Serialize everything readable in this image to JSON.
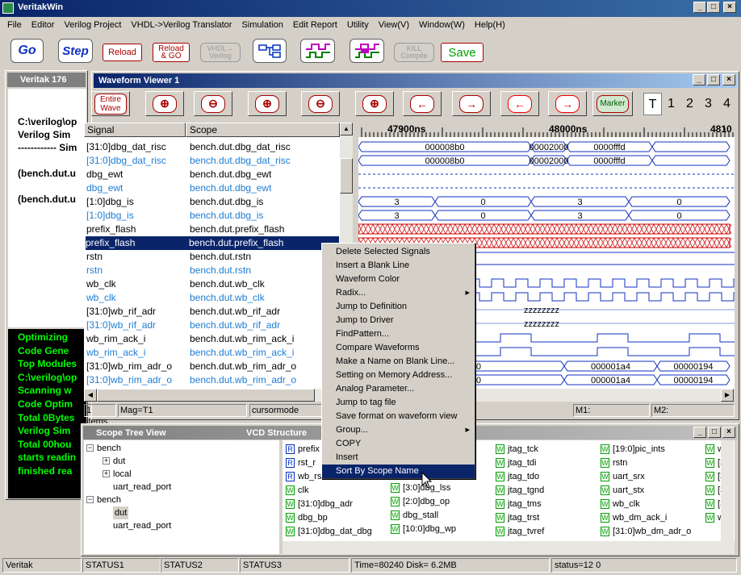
{
  "app": {
    "title": "VeritakWin"
  },
  "menu": [
    "File",
    "Editor",
    "Verilog Project",
    "VHDL->Verilog Translator",
    "Simulation",
    "Edit Report",
    "Utility",
    "View(V)",
    "Window(W)",
    "Help(H)"
  ],
  "toolbar": {
    "go": "Go",
    "step": "Step",
    "reload": "Reload",
    "reload_go_1": "Reload",
    "reload_go_2": "& GO",
    "vhdl_1": "VHDL→",
    "vhdl_2": "Verilog",
    "kill_1": "KILL",
    "kill_2": "Compile",
    "save": "Save"
  },
  "console": {
    "title": "Veritak 176",
    "lines": [
      "C:\\verilog\\op",
      "Verilog Sim",
      "------------ Sim",
      "(bench.dut.u",
      "(bench.dut.u"
    ]
  },
  "green_console": {
    "lines": [
      "Optimizing",
      "Code Gene",
      "Top Modules",
      "C:\\verilog\\op",
      "Scanning w",
      "Code Optim",
      "Total 0Bytes",
      "Verilog Sim",
      "Total 00hou",
      "starts readin",
      "finished rea"
    ]
  },
  "waveform": {
    "title": "Waveform Viewer 1",
    "entire_wave_1": "Entire",
    "entire_wave_2": "Wave",
    "marker": "Marker",
    "tabs": [
      "T",
      "1",
      "2",
      "3",
      "4"
    ],
    "col_signal": "Signal",
    "col_scope": "Scope",
    "signals": [
      {
        "name": "[31:0]dbg_dat_risc",
        "scope": "bench.dut.dbg_dat_risc",
        "blue": false
      },
      {
        "name": "[31:0]dbg_dat_risc",
        "scope": "bench.dut.dbg_dat_risc",
        "blue": true
      },
      {
        "name": "dbg_ewt",
        "scope": "bench.dut.dbg_ewt",
        "blue": false
      },
      {
        "name": "dbg_ewt",
        "scope": "bench.dut.dbg_ewt",
        "blue": true
      },
      {
        "name": "[1:0]dbg_is",
        "scope": "bench.dut.dbg_is",
        "blue": false
      },
      {
        "name": "[1:0]dbg_is",
        "scope": "bench.dut.dbg_is",
        "blue": true
      },
      {
        "name": "prefix_flash",
        "scope": "bench.dut.prefix_flash",
        "blue": false
      },
      {
        "name": "prefix_flash",
        "scope": "bench.dut.prefix_flash",
        "blue": false,
        "selected": true
      },
      {
        "name": "rstn",
        "scope": "bench.dut.rstn",
        "blue": false
      },
      {
        "name": "rstn",
        "scope": "bench.dut.rstn",
        "blue": true
      },
      {
        "name": "wb_clk",
        "scope": "bench.dut.wb_clk",
        "blue": false
      },
      {
        "name": "wb_clk",
        "scope": "bench.dut.wb_clk",
        "blue": true
      },
      {
        "name": "[31:0]wb_rif_adr",
        "scope": "bench.dut.wb_rif_adr",
        "blue": false
      },
      {
        "name": "[31:0]wb_rif_adr",
        "scope": "bench.dut.wb_rif_adr",
        "blue": true
      },
      {
        "name": "wb_rim_ack_i",
        "scope": "bench.dut.wb_rim_ack_i",
        "blue": false
      },
      {
        "name": "wb_rim_ack_i",
        "scope": "bench.dut.wb_rim_ack_i",
        "blue": true
      },
      {
        "name": "[31:0]wb_rim_adr_o",
        "scope": "bench.dut.wb_rim_adr_o",
        "blue": false
      },
      {
        "name": "[31:0]wb_rim_adr_o",
        "scope": "bench.dut.wb_rim_adr_o",
        "blue": true
      }
    ],
    "time_labels": [
      "47900ns",
      "48000ns",
      "4810"
    ],
    "bus_vals_1": [
      "000008b0",
      "00002000",
      "0000fffd"
    ],
    "bus_vals_2": [
      "000008b0",
      "00002000",
      "0000fffd"
    ],
    "is_vals": [
      "3",
      "0",
      "3",
      "0"
    ],
    "zz": "zzzzzzzz",
    "adr_vals": [
      "000001a0",
      "000001a4",
      "00000194"
    ],
    "status": {
      "items": "1 items.",
      "mag": "Mag=T1",
      "mode": "cursormode",
      "m1": "M1:",
      "m2": "M2:"
    }
  },
  "context_menu": {
    "items": [
      "Delete Selected Signals",
      "Insert a Blank Line",
      "Waveform Color",
      "Radix...",
      "Jump to Definition",
      "Jump to Driver",
      "FindPattern...",
      "Compare Waveforms",
      "Make a Name on Blank Line...",
      "Setting on Memory Address...",
      "Analog Parameter...",
      "Jump to tag file",
      "Save format on waveform view",
      "Group...",
      "COPY",
      "Insert",
      "Sort By Scope Name"
    ]
  },
  "scope_tree": {
    "title": "Scope Tree View",
    "vcd_title": "VCD Structure",
    "nodes": [
      "bench",
      "dut",
      "local",
      "uart_read_port",
      "bench",
      "dut",
      "uart_read_port"
    ]
  },
  "vcd": {
    "col1": [
      [
        "R",
        "prefix"
      ],
      [
        "R",
        "rst_r"
      ],
      [
        "R",
        "wb_rs"
      ],
      [
        "W",
        "clk"
      ],
      [
        "W",
        "[31:0]dbg_adr"
      ],
      [
        "W",
        "dbg_bp"
      ],
      [
        "W",
        "[31:0]dbg_dat_dbg"
      ]
    ],
    "col2": [
      [
        "W",
        "[3:0]dbg_lss"
      ],
      [
        "W",
        "[2:0]dbg_op"
      ],
      [
        "W",
        "dbg_stall"
      ],
      [
        "W",
        "[10:0]dbg_wp"
      ]
    ],
    "col3": [
      [
        "W",
        "jtag_tck"
      ],
      [
        "W",
        "jtag_tdi"
      ],
      [
        "W",
        "jtag_tdo"
      ],
      [
        "W",
        "jtag_tgnd"
      ],
      [
        "W",
        "jtag_tms"
      ],
      [
        "W",
        "jtag_trst"
      ],
      [
        "W",
        "jtag_tvref"
      ]
    ],
    "col4": [
      [
        "W",
        "[19:0]pic_ints"
      ],
      [
        "W",
        "rstn"
      ],
      [
        "W",
        "uart_srx"
      ],
      [
        "W",
        "uart_stx"
      ],
      [
        "W",
        "wb_clk"
      ],
      [
        "W",
        "wb_dm_ack_i"
      ],
      [
        "W",
        "[31:0]wb_dm_adr_o"
      ]
    ],
    "col5": [
      [
        "W",
        "wb_"
      ],
      [
        "W",
        "[31"
      ],
      [
        "W",
        "[31"
      ],
      [
        "W",
        "[31"
      ],
      [
        "W",
        "[3:0"
      ],
      [
        "W",
        "wb_"
      ]
    ]
  },
  "statusbar": [
    "Veritak",
    "STATUS1",
    "STATUS2",
    "STATUS3",
    "Time=80240 Disk= 6.2MB",
    "status=12 0"
  ]
}
